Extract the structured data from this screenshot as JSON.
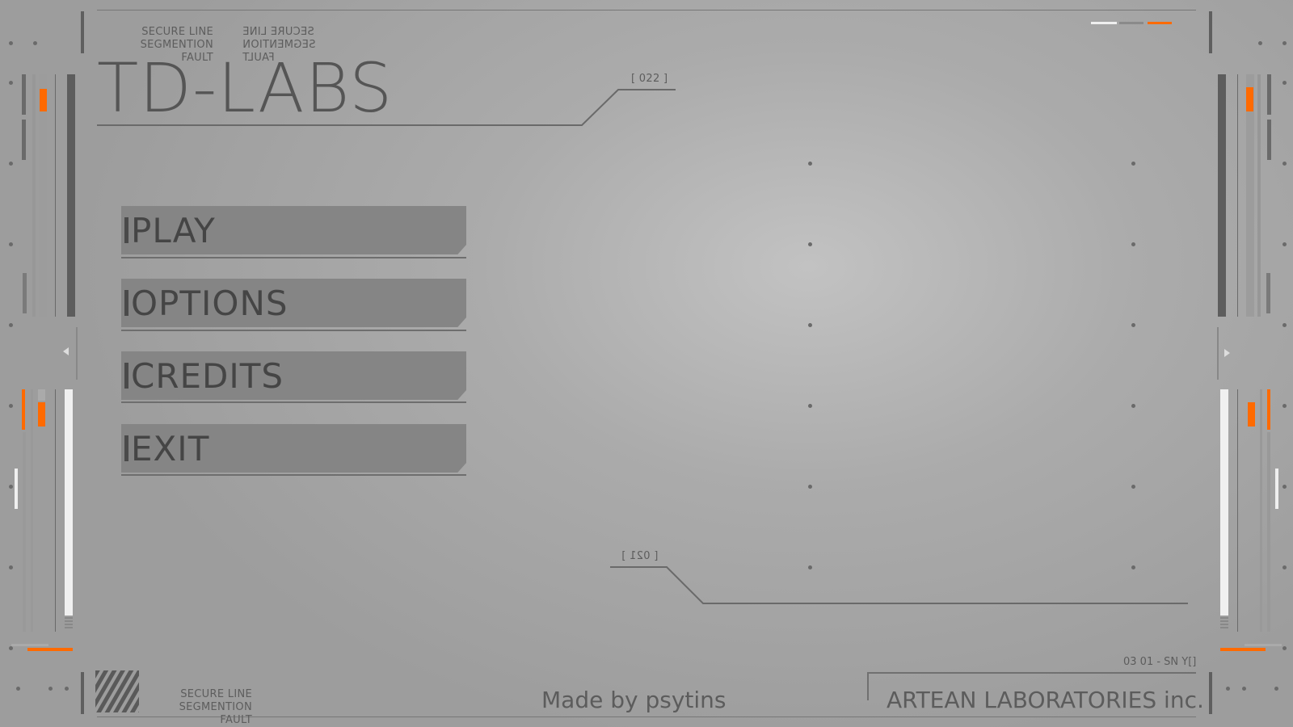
{
  "header": {
    "label_line1": "SECURE LINE",
    "label_line2": "SEGMENTION FAULT",
    "title": "TD-LABS",
    "code_top": "[ 022 ]"
  },
  "menu": {
    "items": [
      {
        "label": "PLAY"
      },
      {
        "label": "OPTIONS"
      },
      {
        "label": "CREDITS"
      },
      {
        "label": "EXIT"
      }
    ]
  },
  "middle": {
    "code_bottom": "[ 021 ]"
  },
  "footer": {
    "label_line1": "SECURE LINE",
    "label_line2": "SEGMENTION FAULT",
    "credit": "Made by psytins",
    "serial": "03 01 - SN Y[]",
    "company": "ARTEAN LABORATORIES inc."
  },
  "colors": {
    "accent": "#ff6a00",
    "background": "#aaaaaa",
    "button": "#858585"
  }
}
